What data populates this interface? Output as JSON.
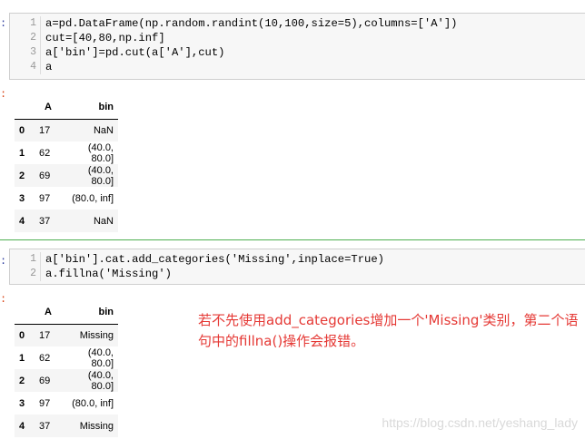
{
  "cell1": {
    "lines": [
      {
        "num": "1",
        "code": "a=pd.DataFrame(np.random.randint(10,100,size=5),columns=['A'])"
      },
      {
        "num": "2",
        "code": "cut=[40,80,np.inf]"
      },
      {
        "num": "3",
        "code": "a['bin']=pd.cut(a['A'],cut)"
      },
      {
        "num": "4",
        "code": "a"
      }
    ]
  },
  "table1": {
    "headers": [
      "",
      "A",
      "bin"
    ],
    "rows": [
      {
        "idx": "0",
        "A": "17",
        "bin": "NaN"
      },
      {
        "idx": "1",
        "A": "62",
        "bin": "(40.0, 80.0]"
      },
      {
        "idx": "2",
        "A": "69",
        "bin": "(40.0, 80.0]"
      },
      {
        "idx": "3",
        "A": "97",
        "bin": "(80.0, inf]"
      },
      {
        "idx": "4",
        "A": "37",
        "bin": "NaN"
      }
    ]
  },
  "cell2": {
    "lines": [
      {
        "num": "1",
        "code": "a['bin'].cat.add_categories('Missing',inplace=True)"
      },
      {
        "num": "2",
        "code": "a.fillna('Missing')"
      }
    ]
  },
  "table2": {
    "headers": [
      "",
      "A",
      "bin"
    ],
    "rows": [
      {
        "idx": "0",
        "A": "17",
        "bin": "Missing"
      },
      {
        "idx": "1",
        "A": "62",
        "bin": "(40.0, 80.0]"
      },
      {
        "idx": "2",
        "A": "69",
        "bin": "(40.0, 80.0]"
      },
      {
        "idx": "3",
        "A": "97",
        "bin": "(80.0, inf]"
      },
      {
        "idx": "4",
        "A": "37",
        "bin": "Missing"
      }
    ]
  },
  "note": "若不先使用add_categories增加一个'Missing'类别，第二个语句中的fillna()操作会报错。",
  "watermark": "https://blog.csdn.net/yeshang_lady",
  "colors": {
    "accent_divider": "#4caf50",
    "note_red": "#e53935",
    "prompt_blue": "#303f9f"
  }
}
